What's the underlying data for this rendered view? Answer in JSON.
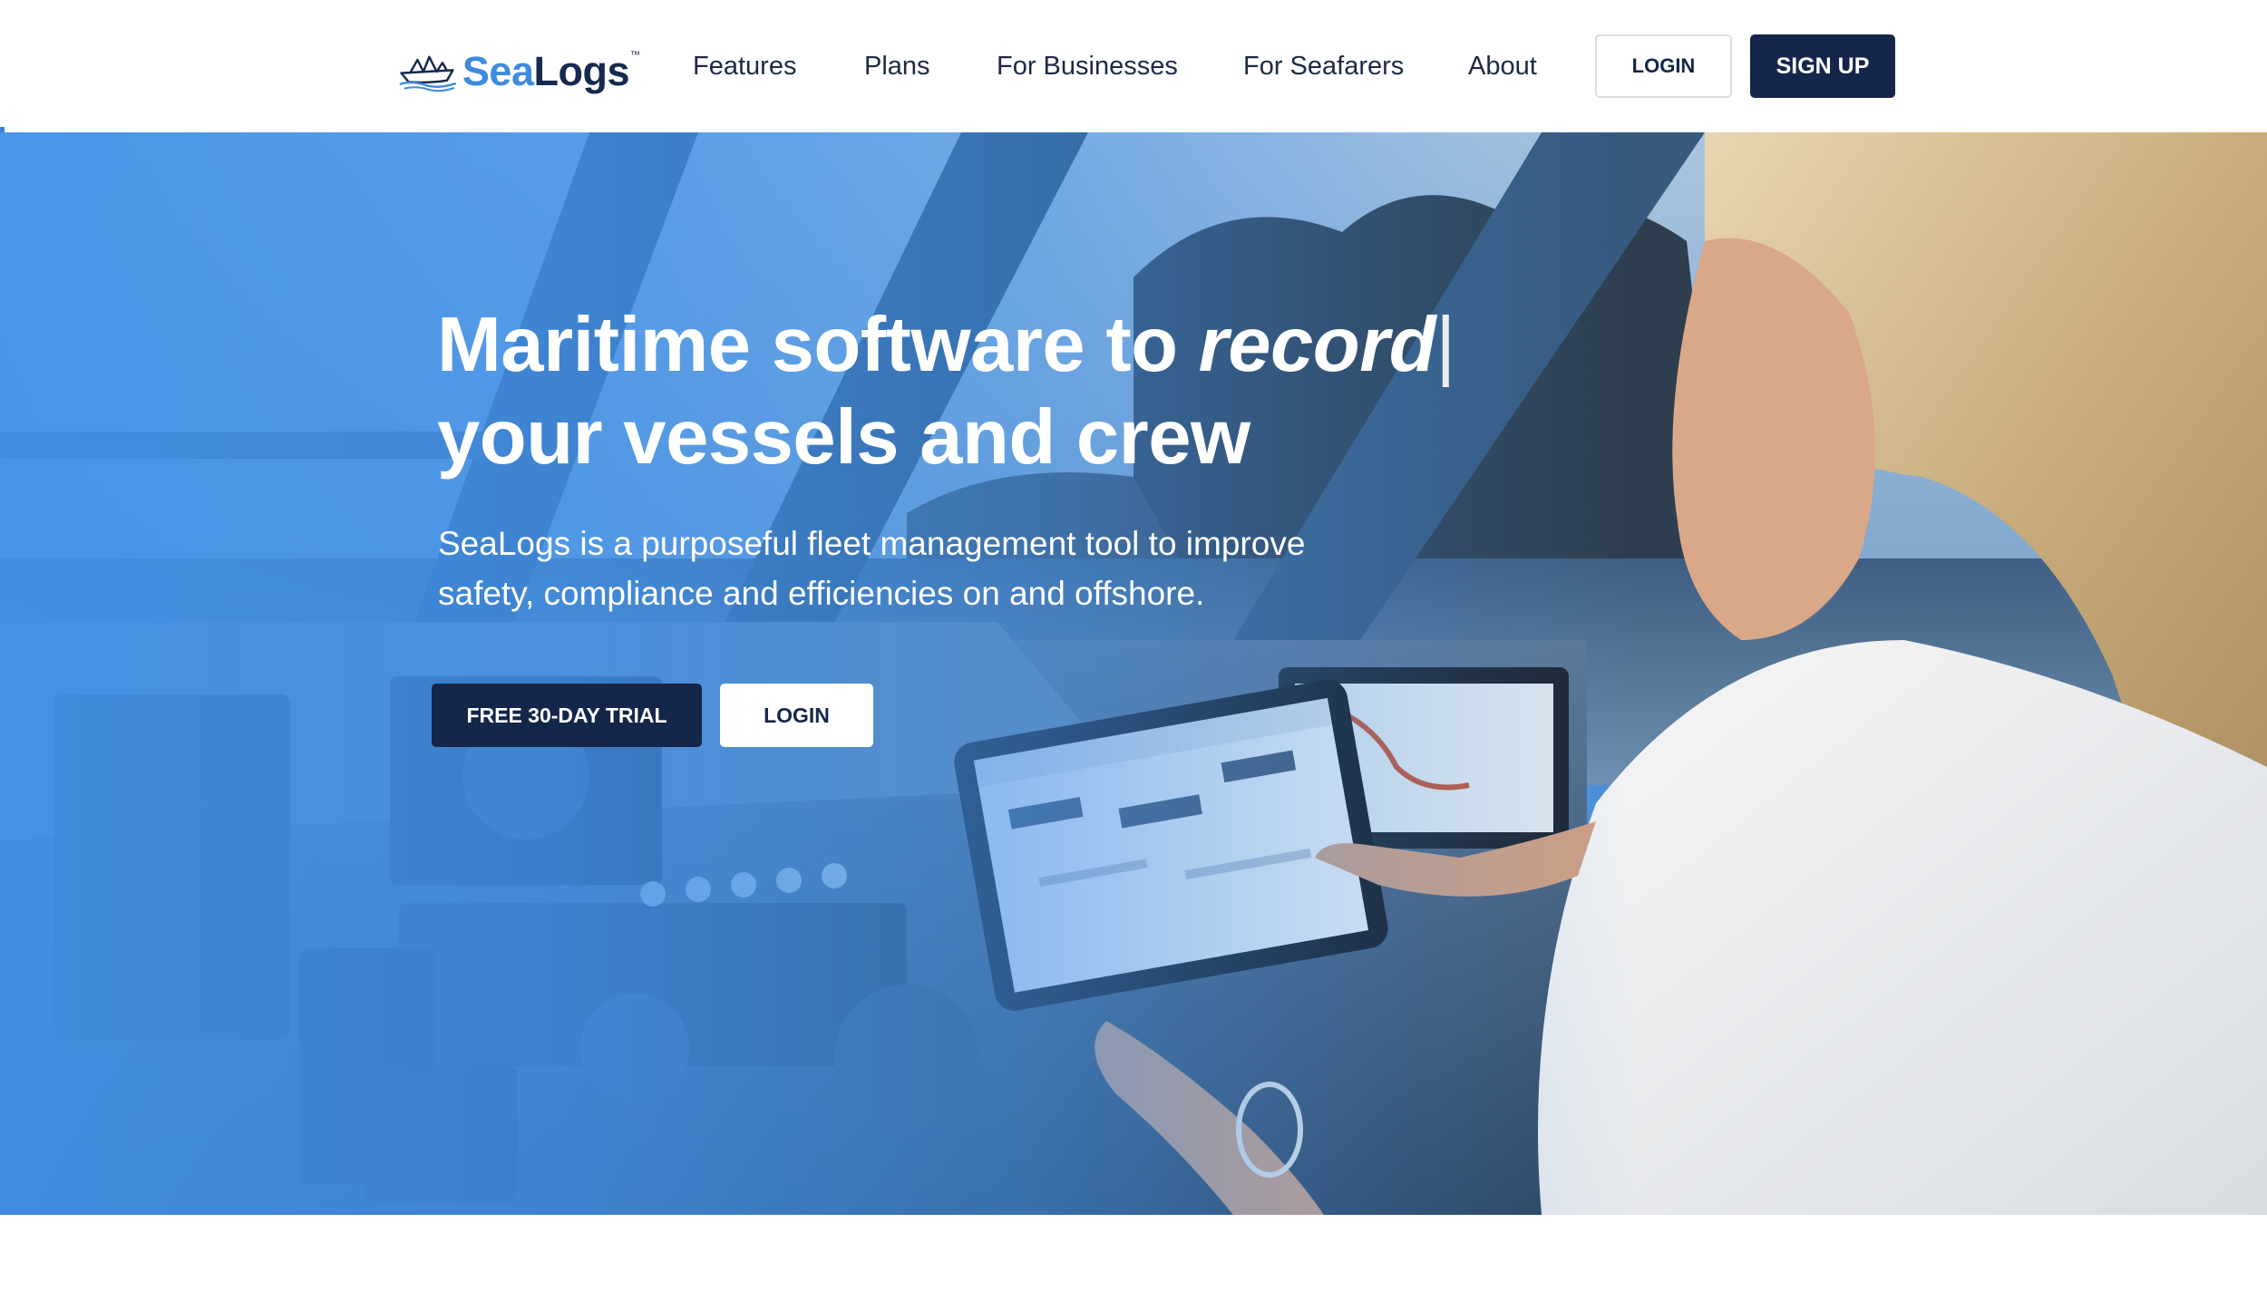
{
  "header": {
    "logo": {
      "sea": "Sea",
      "logs": "Logs",
      "tm": "™",
      "icon": "paper-boat-icon"
    },
    "nav": [
      {
        "label": "Features"
      },
      {
        "label": "Plans"
      },
      {
        "label": "For Businesses"
      },
      {
        "label": "For Seafarers"
      },
      {
        "label": "About"
      }
    ],
    "login_label": "LOGIN",
    "signup_label": "SIGN UP"
  },
  "hero": {
    "title_line1_prefix": "Maritime software to ",
    "title_line1_emphasis": "record",
    "title_caret": "|",
    "title_line2": "your vessels and crew",
    "subtitle_line1": "SeaLogs is a purposeful fleet management tool to improve",
    "subtitle_line2": "safety, compliance and efficiencies on and offshore.",
    "trial_label": "FREE 30-DAY TRIAL",
    "login_label": "LOGIN",
    "image": "woman-using-tablet-on-boat-bridge"
  },
  "colors": {
    "brand_navy": "#14264a",
    "brand_blue": "#3d8bdf",
    "hero_overlay": "#4292ea"
  }
}
